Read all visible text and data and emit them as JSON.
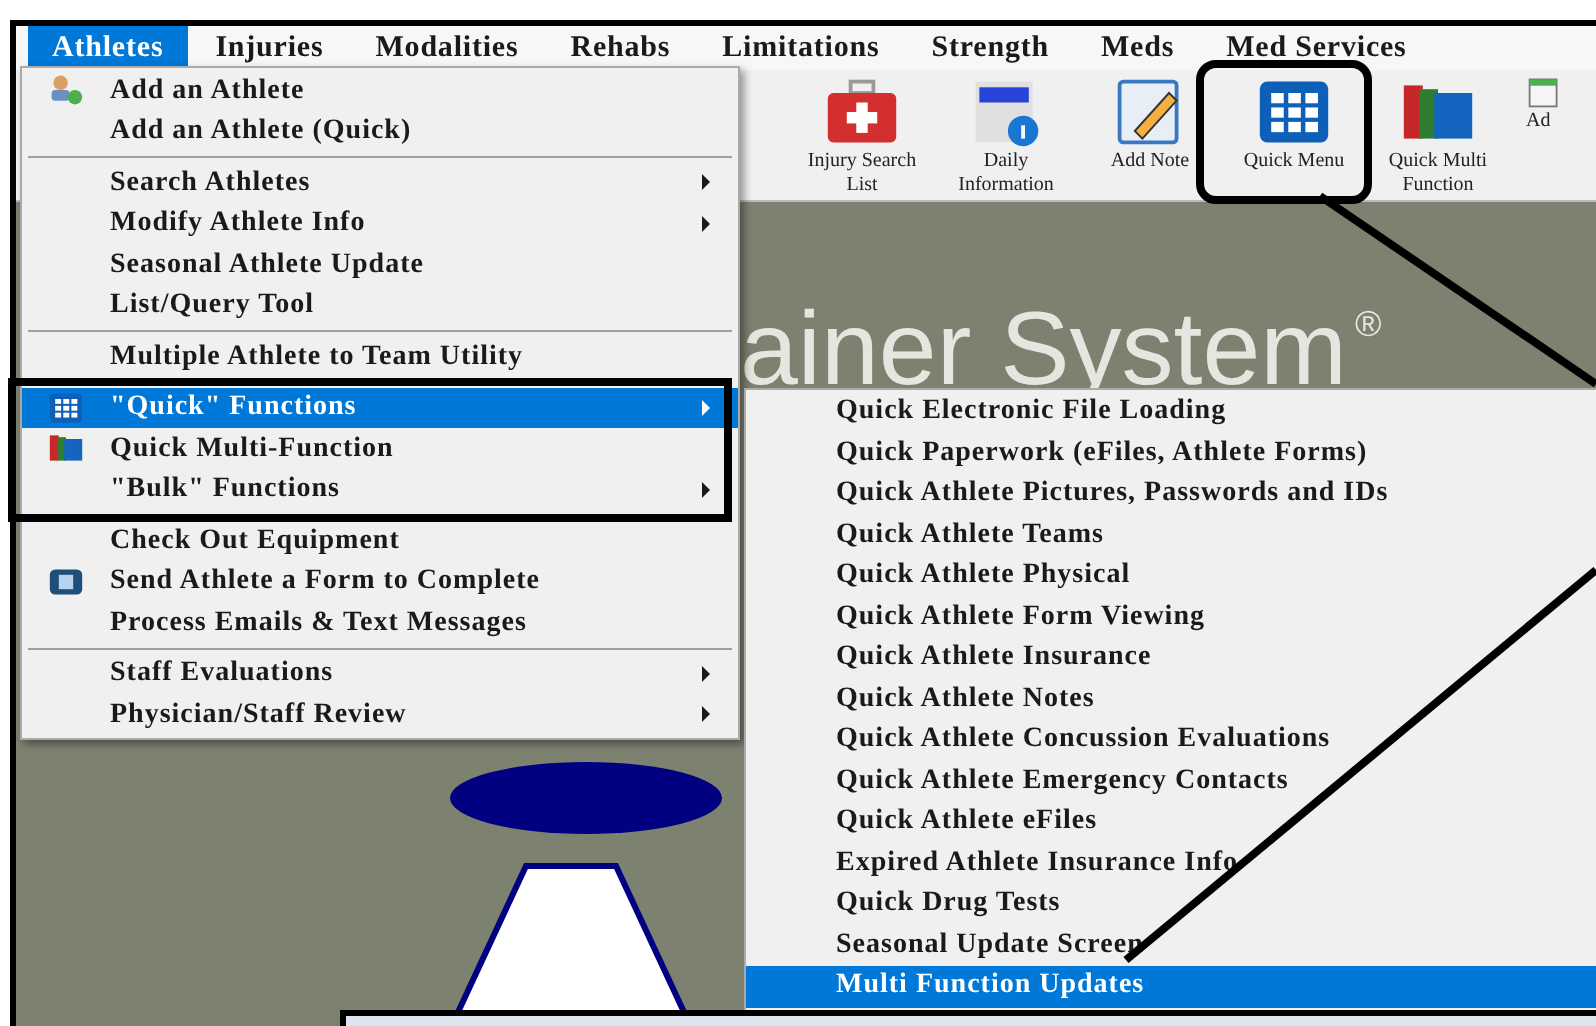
{
  "menu_bar": [
    {
      "label": "Athletes",
      "selected": true
    },
    {
      "label": "Injuries",
      "selected": false
    },
    {
      "label": "Modalities",
      "selected": false
    },
    {
      "label": "Rehabs",
      "selected": false
    },
    {
      "label": "Limitations",
      "selected": false
    },
    {
      "label": "Strength",
      "selected": false
    },
    {
      "label": "Meds",
      "selected": false
    },
    {
      "label": "Med Services",
      "selected": false
    }
  ],
  "toolbar": [
    {
      "label": "Injury Search List",
      "kind": "medkit"
    },
    {
      "label": "Daily Information",
      "kind": "daily"
    },
    {
      "label": "Add Note",
      "kind": "note"
    },
    {
      "label": "Quick Menu",
      "kind": "grid"
    },
    {
      "label": "Quick Multi Function",
      "kind": "books"
    },
    {
      "label": "Ad",
      "kind": "calendar"
    }
  ],
  "logo_text": "ainer System",
  "logo_mark": "®",
  "athletes_menu": {
    "sections": [
      {
        "items": [
          {
            "label": "Add an Athlete",
            "kind": "people",
            "submenu": false,
            "selected": false
          },
          {
            "label": "Add an Athlete (Quick)",
            "submenu": false,
            "selected": false
          }
        ]
      },
      {
        "items": [
          {
            "label": "Search Athletes",
            "submenu": true,
            "selected": false
          },
          {
            "label": "Modify Athlete Info",
            "submenu": true,
            "selected": false
          },
          {
            "label": "Seasonal Athlete Update",
            "submenu": false,
            "selected": false
          },
          {
            "label": "List/Query Tool",
            "submenu": false,
            "selected": false
          }
        ]
      },
      {
        "items": [
          {
            "label": "Multiple Athlete to Team Utility",
            "submenu": false,
            "selected": false
          }
        ]
      },
      {
        "items": [
          {
            "label": "\"Quick\" Functions",
            "kind": "grid",
            "submenu": true,
            "selected": true
          },
          {
            "label": "Quick Multi-Function",
            "kind": "books",
            "submenu": false,
            "selected": false
          },
          {
            "label": "\"Bulk\" Functions",
            "submenu": true,
            "selected": false
          }
        ]
      },
      {
        "items": [
          {
            "label": "Check Out Equipment",
            "submenu": false,
            "selected": false
          },
          {
            "label": "Send Athlete a Form to Complete",
            "kind": "form",
            "submenu": false,
            "selected": false
          },
          {
            "label": "Process Emails & Text Messages",
            "submenu": false,
            "selected": false
          }
        ]
      },
      {
        "items": [
          {
            "label": "Staff Evaluations",
            "submenu": true,
            "selected": false
          },
          {
            "label": "Physician/Staff Review",
            "submenu": true,
            "selected": false
          }
        ]
      }
    ]
  },
  "quick_submenu": [
    {
      "label": "Quick Electronic File Loading",
      "selected": false
    },
    {
      "label": "Quick Paperwork (eFiles, Athlete Forms)",
      "selected": false
    },
    {
      "label": "Quick Athlete Pictures, Passwords and IDs",
      "selected": false
    },
    {
      "label": "Quick Athlete Teams",
      "selected": false
    },
    {
      "label": "Quick Athlete Physical",
      "selected": false
    },
    {
      "label": "Quick Athlete Form Viewing",
      "selected": false
    },
    {
      "label": "Quick Athlete Insurance",
      "selected": false
    },
    {
      "label": "Quick Athlete Notes",
      "selected": false
    },
    {
      "label": "Quick Athlete Concussion Evaluations",
      "selected": false
    },
    {
      "label": "Quick Athlete Emergency Contacts",
      "selected": false
    },
    {
      "label": "Quick Athlete eFiles",
      "selected": false
    },
    {
      "label": "Expired Athlete Insurance Info",
      "selected": false
    },
    {
      "label": "Quick Drug Tests",
      "selected": false
    },
    {
      "label": "Seasonal Update Screen",
      "selected": false
    },
    {
      "label": "Multi Function Updates",
      "selected": true
    }
  ]
}
